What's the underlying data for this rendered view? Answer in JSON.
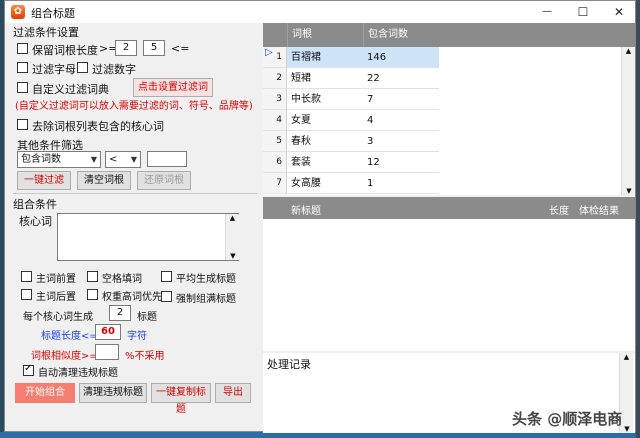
{
  "window": {
    "title": "组合标题",
    "icon_glyph": "✿",
    "minimize": "—",
    "maximize": "☐",
    "close": "✕"
  },
  "filter": {
    "group_title": "过滤条件设置",
    "keep_length_label": "保留词根长度",
    "ge": ">=",
    "min_value": "2",
    "max_value": "5",
    "le": "<=",
    "filter_letters": "过滤字母",
    "filter_digits": "过滤数字",
    "custom_dict": "自定义过滤词典",
    "set_dict_button": "点击设置过滤词",
    "custom_hint": "(自定义过滤词可以放入需要过滤的词、符号、品牌等)",
    "remove_core": "去除词根列表包含的核心词",
    "other_label": "其他条件筛选",
    "field_select": "包含词数",
    "op_select": "<",
    "value_input": "",
    "one_key_filter": "一键过滤",
    "clear_roots": "清空词根",
    "restore_roots": "还原词根"
  },
  "combine": {
    "group_title": "组合条件",
    "core_label": "核心词",
    "core_value": "",
    "opt_front": "主词前置",
    "opt_space": "空格填词",
    "opt_avg": "平均生成标题",
    "opt_back": "主词后置",
    "opt_weight": "权重高词优先",
    "opt_force": "强制组满标题",
    "per_core_label": "每个核心词生成",
    "per_core_value": "2",
    "per_core_unit": "标题",
    "len_label": "标题长度<=",
    "len_value": "60",
    "len_unit": "字符",
    "sim_label": "词根相似度>=",
    "sim_value": "",
    "sim_unit": "%不采用",
    "auto_clean": "自动清理违规标题",
    "start_button": "开始组合",
    "clean_button": "清理违规标题",
    "copy_button": "一键复制标题",
    "export_button": "导出"
  },
  "root_grid": {
    "col1": "词根",
    "col2": "包含词数",
    "current_marker": "▷",
    "rows": [
      {
        "n": "1",
        "word": "百褶裙",
        "count": "146"
      },
      {
        "n": "2",
        "word": "短裙",
        "count": "22"
      },
      {
        "n": "3",
        "word": "中长款",
        "count": "7"
      },
      {
        "n": "4",
        "word": "女夏",
        "count": "4"
      },
      {
        "n": "5",
        "word": "春秋",
        "count": "3"
      },
      {
        "n": "6",
        "word": "套装",
        "count": "12"
      },
      {
        "n": "7",
        "word": "女高腰",
        "count": "1"
      }
    ]
  },
  "title_grid": {
    "col1": "新标题",
    "col2": "长度",
    "col3": "体检结果"
  },
  "log": {
    "label": "处理记录"
  },
  "watermark": "头条 @顺泽电商",
  "colors": {
    "header_gray": "#8b8b8b",
    "red_text": "#e00000",
    "blue_text": "#1a3cff",
    "start_button": "#f47e72",
    "selected_row": "#cde3f7"
  }
}
